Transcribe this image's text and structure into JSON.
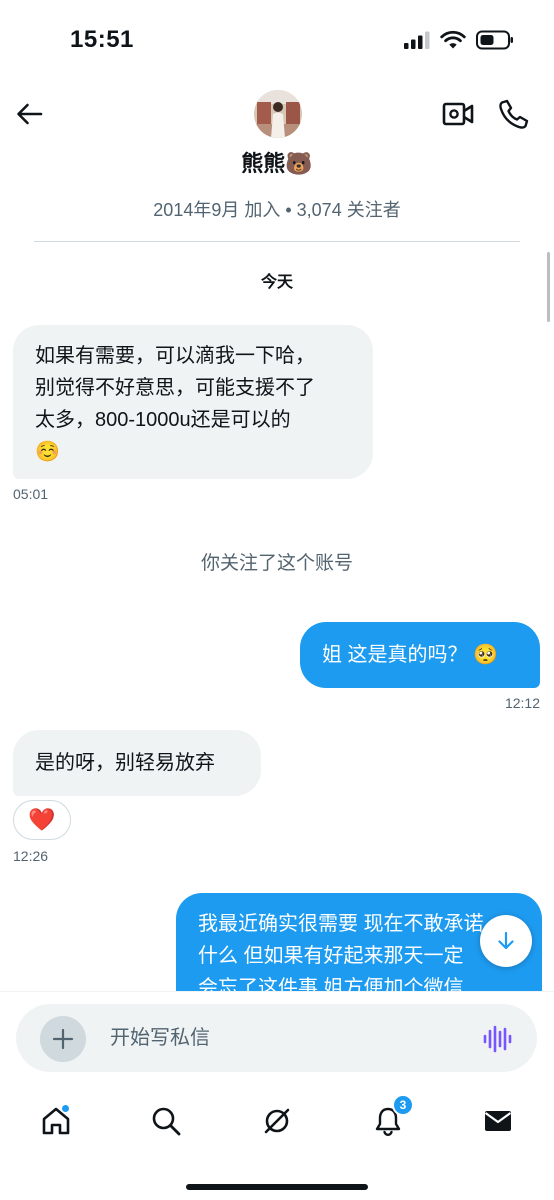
{
  "status_bar": {
    "time": "15:51"
  },
  "header": {
    "display_name": "熊熊🐻",
    "join_info": "2014年9月 加入 • 3,074 关注者"
  },
  "conversation": {
    "day_label": "今天",
    "system_note": "你关注了这个账号",
    "messages": [
      {
        "direction": "incoming",
        "lines": [
          "如果有需要，可以滴我一下哈，",
          "别觉得不好意思，可能支援不了",
          "太多，800-1000u还是可以的",
          "☺️"
        ],
        "time": "05:01"
      },
      {
        "direction": "outgoing",
        "lines": [
          "姐 这是真的吗？ 🥺"
        ],
        "time": "12:12"
      },
      {
        "direction": "incoming",
        "lines": [
          "是的呀，别轻易放弃"
        ],
        "reaction": "❤️",
        "time": "12:26"
      },
      {
        "direction": "outgoing",
        "lines": [
          "我最近确实很需要 现在不敢承诺",
          "什么 但如果有好起来那天一定",
          "会忘了这件事 姐方便加个微信"
        ]
      }
    ]
  },
  "composer": {
    "placeholder": "开始写私信"
  },
  "bottom_nav": {
    "items": [
      {
        "name": "home",
        "icon": "home-icon"
      },
      {
        "name": "search",
        "icon": "search-icon"
      },
      {
        "name": "grok",
        "icon": "grok-icon"
      },
      {
        "name": "notifications",
        "icon": "bell-icon",
        "badge": "3"
      },
      {
        "name": "messages",
        "icon": "mail-icon"
      }
    ]
  },
  "colors": {
    "accent": "#1d9bf0",
    "incoming_bubble": "#eff3f4",
    "secondary_text": "#536471",
    "voice_icon": "#7856ff",
    "reaction_heart": "#e0245e"
  }
}
